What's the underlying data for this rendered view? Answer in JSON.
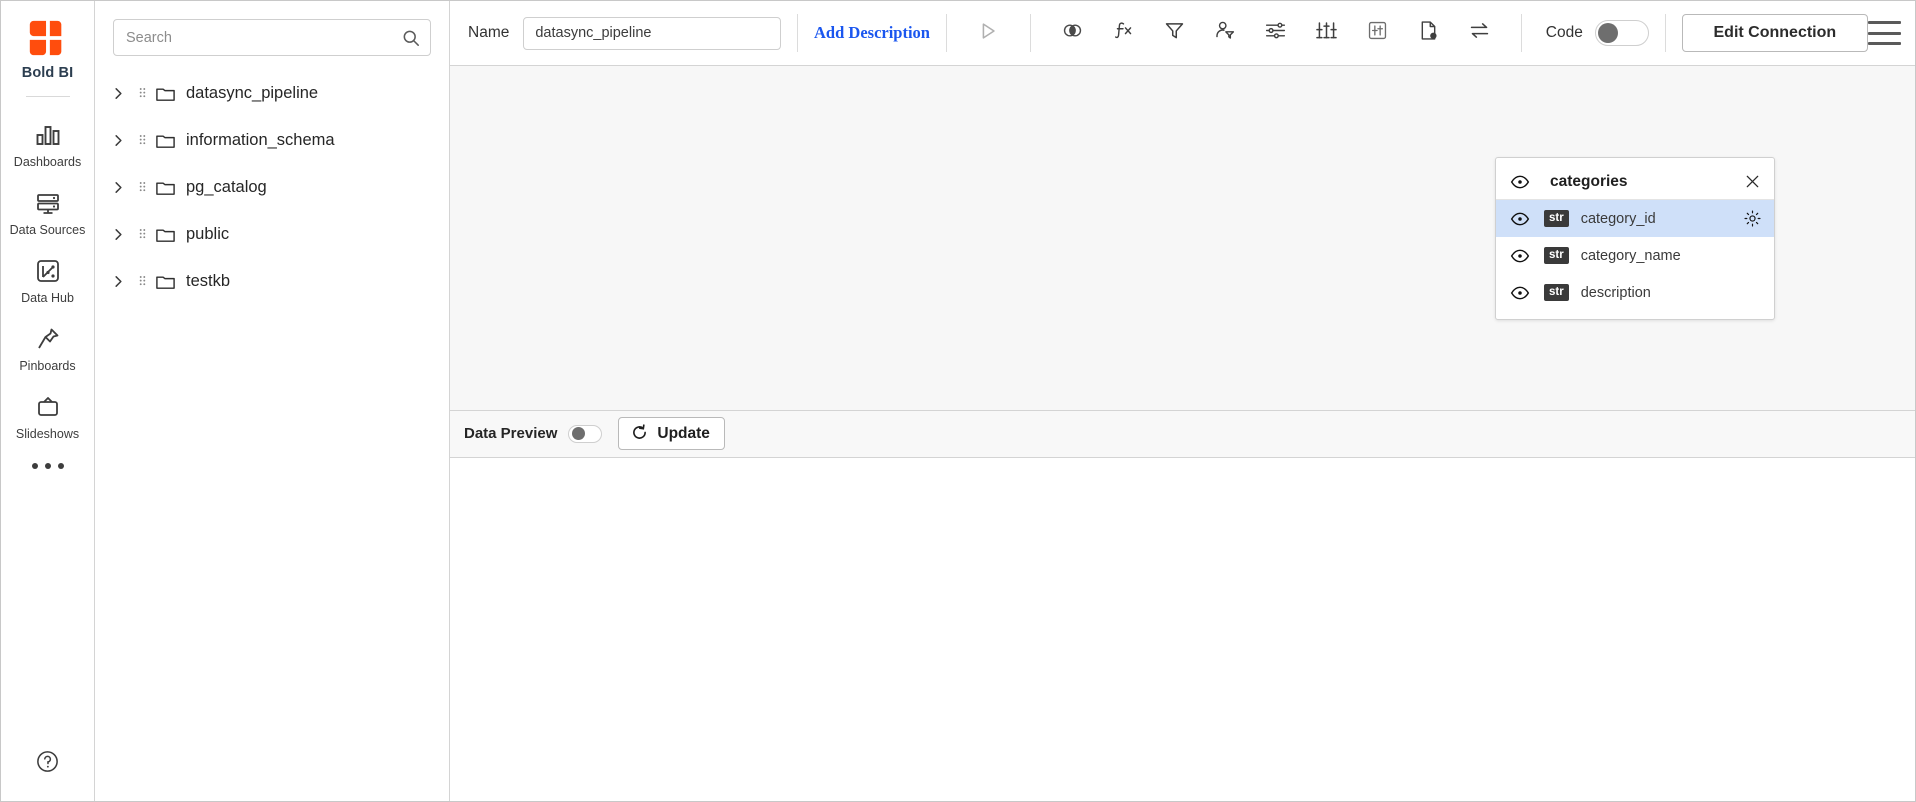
{
  "app": {
    "brand": "Bold BI",
    "logo_color": "#ff4d0d"
  },
  "rail": {
    "items": [
      {
        "label": "Dashboards",
        "icon": "bar-chart-icon"
      },
      {
        "label": "Data Sources",
        "icon": "database-icon"
      },
      {
        "label": "Data Hub",
        "icon": "data-hub-icon"
      },
      {
        "label": "Pinboards",
        "icon": "pin-icon"
      },
      {
        "label": "Slideshows",
        "icon": "tv-icon"
      }
    ],
    "more_label": "more-options",
    "help_label": "help"
  },
  "explorer": {
    "search": {
      "value": "",
      "placeholder": "Search",
      "icon": "search-icon"
    },
    "tree": [
      {
        "label": "datasync_pipeline",
        "icon": "folder-icon",
        "expanded": false
      },
      {
        "label": "information_schema",
        "icon": "folder-icon",
        "expanded": false
      },
      {
        "label": "pg_catalog",
        "icon": "folder-icon",
        "expanded": false
      },
      {
        "label": "public",
        "icon": "folder-icon",
        "expanded": false
      },
      {
        "label": "testkb",
        "icon": "folder-icon",
        "expanded": false
      }
    ]
  },
  "toolbar": {
    "name_label": "Name",
    "name_value": "datasync_pipeline",
    "name_placeholder": "Name",
    "add_description": "Add Description",
    "icons": [
      {
        "name": "run-icon",
        "title": "Run"
      },
      {
        "name": "join-icon",
        "title": "Join"
      },
      {
        "name": "formula-icon",
        "title": "Expression"
      },
      {
        "name": "filter-icon",
        "title": "Filter"
      },
      {
        "name": "user-filter-icon",
        "title": "User Filter"
      },
      {
        "name": "settings-sliders-icon",
        "title": "Settings"
      },
      {
        "name": "transform-icon",
        "title": "Transform"
      },
      {
        "name": "boxed-transform-icon",
        "title": "Column Settings"
      },
      {
        "name": "file-status-icon",
        "title": "Schema"
      },
      {
        "name": "swap-icon",
        "title": "Swap"
      }
    ],
    "code_label": "Code",
    "code_enabled": false,
    "edit_connection": "Edit Connection",
    "menu_icon": "hamburger-menu-icon"
  },
  "canvas": {
    "table_card": {
      "title": "categories",
      "visible_icon": "eye-icon",
      "close_icon": "close-icon",
      "fields": [
        {
          "name": "category_id",
          "type": "str",
          "selected": true,
          "gear": "gear-icon",
          "eye": "eye-icon"
        },
        {
          "name": "category_name",
          "type": "str",
          "selected": false,
          "eye": "eye-icon"
        },
        {
          "name": "description",
          "type": "str",
          "selected": false,
          "eye": "eye-icon"
        }
      ],
      "selected_row_color": "#cfe0f9"
    }
  },
  "preview": {
    "label": "Data Preview",
    "enabled": false,
    "update_label": "Update",
    "refresh_icon": "refresh-icon"
  }
}
